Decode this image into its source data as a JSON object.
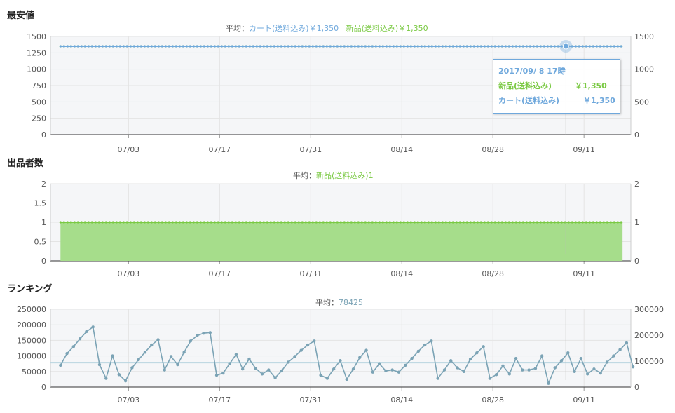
{
  "sections": {
    "price": {
      "title": "最安値",
      "avg_label": "平均：",
      "cart_label": "カート(送料込み)",
      "cart_avg": "￥1,350",
      "new_label": "新品(送料込み)",
      "new_avg": "￥1,350"
    },
    "sellers": {
      "title": "出品者数",
      "avg_label": "平均：",
      "new_label": "新品(送料込み)",
      "new_avg": "1"
    },
    "ranking": {
      "title": "ランキング",
      "avg_label": "平均：",
      "avg_value": "78425"
    }
  },
  "tooltip": {
    "date": "2017/09/ 8 17時",
    "new_label": "新品(送料込み)",
    "new_value": "￥1,350",
    "cart_label": "カート(送料込み)",
    "cart_value": "￥1,350"
  },
  "colors": {
    "cart": "#6fa8dc",
    "new": "#7ac943",
    "new_fill": "#a6dd8b",
    "ranking": "#7ba3b5",
    "ranking_avg": "#b8d5e0",
    "grid": "#e4e4e4",
    "plot_bg": "#f5f6f8"
  },
  "chart_data": [
    {
      "type": "line",
      "title": "最安値",
      "x_ticks": [
        "07/03",
        "07/17",
        "07/31",
        "08/14",
        "08/28",
        "09/11"
      ],
      "x_range": [
        "06/22",
        "09/18"
      ],
      "y_ticks_left": [
        0,
        250,
        500,
        750,
        1000,
        1250,
        1500
      ],
      "y_ticks_right": [
        0,
        500,
        1000,
        1500
      ],
      "ylim": [
        0,
        1500
      ],
      "series": [
        {
          "name": "カート(送料込み)",
          "color": "#6fa8dc",
          "x": [
            "06/22",
            "09/18"
          ],
          "values": [
            1350,
            1350
          ]
        },
        {
          "name": "新品(送料込み)",
          "color": "#7ac943",
          "x": [
            "06/22",
            "09/18"
          ],
          "values": [
            1350,
            1350
          ]
        }
      ],
      "highlight": {
        "x": "09/08",
        "value": 1350
      },
      "grid": true
    },
    {
      "type": "area",
      "title": "出品者数",
      "x_ticks": [
        "07/03",
        "07/17",
        "07/31",
        "08/14",
        "08/28",
        "09/11"
      ],
      "x_range": [
        "06/22",
        "09/18"
      ],
      "y_ticks_left": [
        0,
        0.5,
        1,
        1.5,
        2
      ],
      "y_ticks_right": [
        0,
        1,
        2
      ],
      "ylim": [
        0,
        2
      ],
      "series": [
        {
          "name": "新品(送料込み)",
          "color": "#7ac943",
          "x": [
            "06/22",
            "09/18"
          ],
          "values": [
            1,
            1
          ]
        }
      ],
      "grid": true
    },
    {
      "type": "line",
      "title": "ランキング",
      "x_ticks": [
        "07/03",
        "07/17",
        "07/31",
        "08/14",
        "08/28",
        "09/11"
      ],
      "x_range": [
        "06/22",
        "09/18"
      ],
      "y_ticks_left": [
        0,
        50000,
        100000,
        150000,
        200000,
        250000
      ],
      "y_ticks_right": [
        0,
        100000,
        200000,
        300000
      ],
      "ylim": [
        0,
        250000
      ],
      "average": 78425,
      "series": [
        {
          "name": "ランキング",
          "color": "#7ba3b5",
          "x": [
            "06/22",
            "06/23",
            "06/24",
            "06/25",
            "06/26",
            "06/27",
            "06/28",
            "06/29",
            "06/30",
            "07/01",
            "07/02",
            "07/03",
            "07/04",
            "07/05",
            "07/06",
            "07/07",
            "07/08",
            "07/09",
            "07/10",
            "07/11",
            "07/12",
            "07/13",
            "07/14",
            "07/15",
            "07/16",
            "07/17",
            "07/18",
            "07/19",
            "07/20",
            "07/21",
            "07/22",
            "07/23",
            "07/24",
            "07/25",
            "07/26",
            "07/27",
            "07/28",
            "07/29",
            "07/30",
            "07/31",
            "08/01",
            "08/02",
            "08/03",
            "08/04",
            "08/05",
            "08/06",
            "08/07",
            "08/08",
            "08/09",
            "08/10",
            "08/11",
            "08/12",
            "08/13",
            "08/14",
            "08/15",
            "08/16",
            "08/17",
            "08/18",
            "08/19",
            "08/20",
            "08/21",
            "08/22",
            "08/23",
            "08/24",
            "08/25",
            "08/26",
            "08/27",
            "08/28",
            "08/29",
            "08/30",
            "08/31",
            "09/01",
            "09/02",
            "09/03",
            "09/04",
            "09/05",
            "09/06",
            "09/07",
            "09/08",
            "09/09",
            "09/10",
            "09/11",
            "09/12",
            "09/13",
            "09/14",
            "09/15",
            "09/16",
            "09/17",
            "09/18"
          ],
          "values": [
            70000,
            108000,
            130000,
            155000,
            178000,
            193000,
            72000,
            28000,
            100000,
            40000,
            20000,
            62000,
            88000,
            112000,
            135000,
            152000,
            55000,
            98000,
            72000,
            112000,
            148000,
            165000,
            173000,
            175000,
            38000,
            45000,
            75000,
            105000,
            58000,
            90000,
            60000,
            42000,
            55000,
            30000,
            52000,
            80000,
            98000,
            118000,
            135000,
            148000,
            38000,
            28000,
            58000,
            85000,
            25000,
            58000,
            95000,
            118000,
            48000,
            75000,
            52000,
            55000,
            48000,
            70000,
            92000,
            115000,
            135000,
            148000,
            28000,
            55000,
            85000,
            62000,
            50000,
            90000,
            110000,
            130000,
            28000,
            40000,
            68000,
            42000,
            92000,
            55000,
            55000,
            60000,
            100000,
            12000,
            62000,
            85000,
            110000,
            50000,
            92000,
            42000,
            58000,
            45000,
            80000,
            100000,
            120000,
            142000,
            65000
          ],
          "right_axis_values": [
            80000,
            130000,
            160000,
            188000,
            215000,
            235000,
            85000,
            30000,
            120000,
            45000,
            20000,
            75000,
            105000,
            135000,
            162000,
            185000,
            66000,
            118000,
            86000,
            135000,
            178000,
            198000,
            208000,
            210000,
            45000,
            55000,
            90000,
            126000,
            70000,
            108000,
            72000,
            50000,
            66000,
            36000,
            62000,
            96000,
            118000,
            142000,
            162000,
            178000,
            45000,
            34000,
            70000,
            102000,
            30000,
            70000,
            114000,
            142000,
            58000,
            90000,
            62000,
            66000,
            58000,
            84000,
            110000,
            138000,
            162000,
            178000,
            34000,
            66000,
            102000,
            75000,
            60000,
            108000,
            132000,
            156000,
            34000,
            48000,
            82000,
            50000,
            110000,
            66000,
            66000,
            72000,
            120000,
            14000,
            75000,
            102000,
            132000,
            60000,
            110000,
            50000,
            70000,
            54000,
            96000,
            120000,
            144000,
            170000,
            78000
          ]
        }
      ],
      "grid": true
    }
  ]
}
